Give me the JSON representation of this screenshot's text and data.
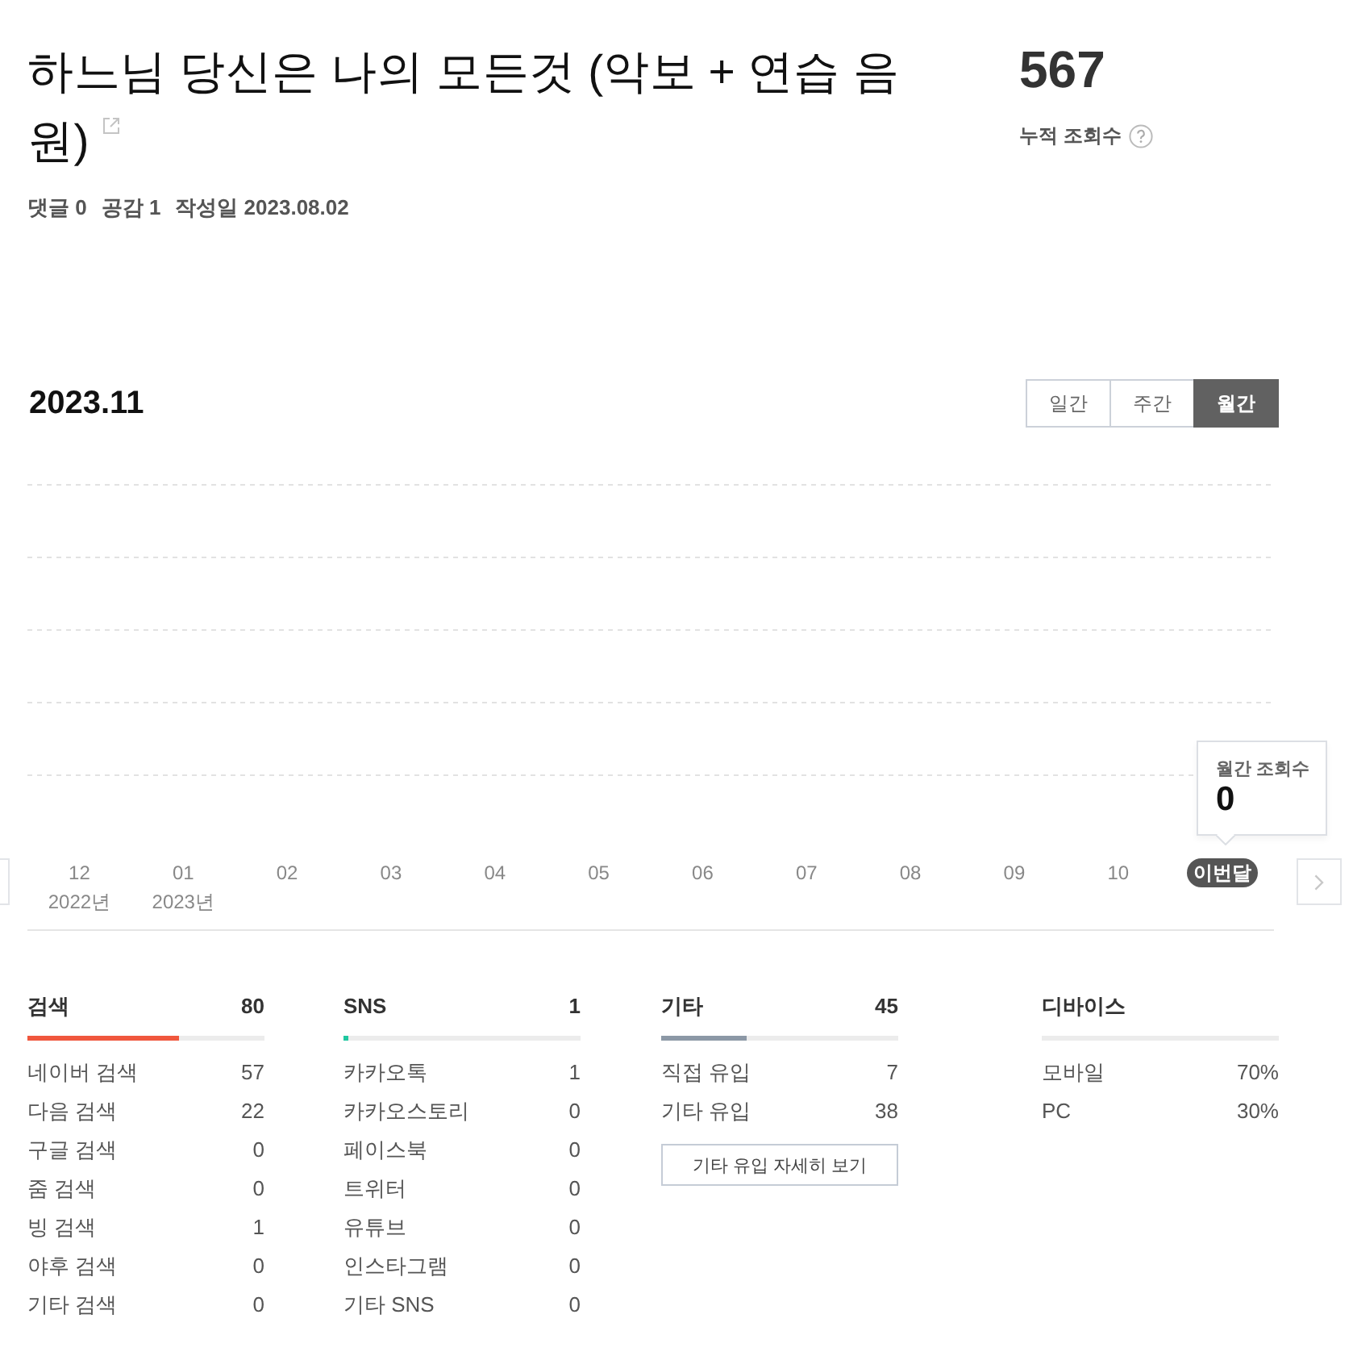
{
  "post": {
    "title": "하느님 당신은 나의 모든것 (악보 + 연습 음원)",
    "meta": [
      {
        "label": "댓글",
        "value": "0"
      },
      {
        "label": "공감",
        "value": "1"
      },
      {
        "label": "작성일",
        "value": "2023.08.02"
      }
    ]
  },
  "total_views": {
    "value": "567",
    "label": "누적 조회수"
  },
  "chart": {
    "period": "2023.11",
    "tabs": [
      {
        "label": "일간",
        "selected": false
      },
      {
        "label": "주간",
        "selected": false
      },
      {
        "label": "월간",
        "selected": true
      }
    ],
    "months": [
      {
        "label": "12",
        "year": "2022년",
        "selected": false
      },
      {
        "label": "01",
        "year": "2023년",
        "selected": false
      },
      {
        "label": "02",
        "selected": false
      },
      {
        "label": "03",
        "selected": false
      },
      {
        "label": "04",
        "selected": false
      },
      {
        "label": "05",
        "selected": false
      },
      {
        "label": "06",
        "selected": false
      },
      {
        "label": "07",
        "selected": false
      },
      {
        "label": "08",
        "selected": false
      },
      {
        "label": "09",
        "selected": false
      },
      {
        "label": "10",
        "selected": false
      },
      {
        "label": "이번달",
        "selected": true
      }
    ],
    "tooltip": {
      "label": "월간 조회수",
      "value": "0"
    }
  },
  "stats": [
    {
      "title": "검색",
      "total": "80",
      "level": 0.64,
      "color": "#f0573d",
      "rows": [
        {
          "label": "네이버 검색",
          "value": "57"
        },
        {
          "label": "다음 검색",
          "value": "22"
        },
        {
          "label": "구글 검색",
          "value": "0"
        },
        {
          "label": "줌 검색",
          "value": "0"
        },
        {
          "label": "빙 검색",
          "value": "1"
        },
        {
          "label": "야후 검색",
          "value": "0"
        },
        {
          "label": "기타 검색",
          "value": "0"
        }
      ]
    },
    {
      "title": "SNS",
      "total": "1",
      "level": 0.02,
      "color": "#1fc7a0",
      "rows": [
        {
          "label": "카카오톡",
          "value": "1"
        },
        {
          "label": "카카오스토리",
          "value": "0"
        },
        {
          "label": "페이스북",
          "value": "0"
        },
        {
          "label": "트위터",
          "value": "0"
        },
        {
          "label": "유튜브",
          "value": "0"
        },
        {
          "label": "인스타그램",
          "value": "0"
        },
        {
          "label": "기타 SNS",
          "value": "0"
        }
      ]
    },
    {
      "title": "기타",
      "total": "45",
      "level": 0.36,
      "color": "#8c98a6",
      "rows": [
        {
          "label": "직접 유입",
          "value": "7"
        },
        {
          "label": "기타 유입",
          "value": "38"
        }
      ],
      "button": "기타 유입 자세히 보기"
    },
    {
      "title": "디바이스",
      "rows": [
        {
          "label": "모바일",
          "value": "70%"
        },
        {
          "label": "PC",
          "value": "30%"
        }
      ]
    }
  ]
}
